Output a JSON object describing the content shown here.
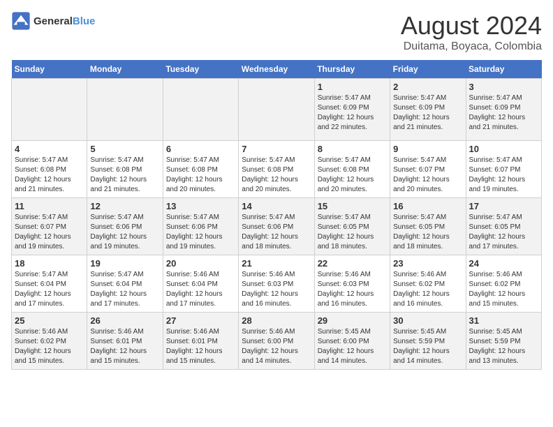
{
  "logo": {
    "line1": "General",
    "line2": "Blue"
  },
  "title": "August 2024",
  "subtitle": "Duitama, Boyaca, Colombia",
  "days_of_week": [
    "Sunday",
    "Monday",
    "Tuesday",
    "Wednesday",
    "Thursday",
    "Friday",
    "Saturday"
  ],
  "weeks": [
    [
      {
        "day": "",
        "info": ""
      },
      {
        "day": "",
        "info": ""
      },
      {
        "day": "",
        "info": ""
      },
      {
        "day": "",
        "info": ""
      },
      {
        "day": "1",
        "info": "Sunrise: 5:47 AM\nSunset: 6:09 PM\nDaylight: 12 hours\nand 22 minutes."
      },
      {
        "day": "2",
        "info": "Sunrise: 5:47 AM\nSunset: 6:09 PM\nDaylight: 12 hours\nand 21 minutes."
      },
      {
        "day": "3",
        "info": "Sunrise: 5:47 AM\nSunset: 6:09 PM\nDaylight: 12 hours\nand 21 minutes."
      }
    ],
    [
      {
        "day": "4",
        "info": "Sunrise: 5:47 AM\nSunset: 6:08 PM\nDaylight: 12 hours\nand 21 minutes."
      },
      {
        "day": "5",
        "info": "Sunrise: 5:47 AM\nSunset: 6:08 PM\nDaylight: 12 hours\nand 21 minutes."
      },
      {
        "day": "6",
        "info": "Sunrise: 5:47 AM\nSunset: 6:08 PM\nDaylight: 12 hours\nand 20 minutes."
      },
      {
        "day": "7",
        "info": "Sunrise: 5:47 AM\nSunset: 6:08 PM\nDaylight: 12 hours\nand 20 minutes."
      },
      {
        "day": "8",
        "info": "Sunrise: 5:47 AM\nSunset: 6:08 PM\nDaylight: 12 hours\nand 20 minutes."
      },
      {
        "day": "9",
        "info": "Sunrise: 5:47 AM\nSunset: 6:07 PM\nDaylight: 12 hours\nand 20 minutes."
      },
      {
        "day": "10",
        "info": "Sunrise: 5:47 AM\nSunset: 6:07 PM\nDaylight: 12 hours\nand 19 minutes."
      }
    ],
    [
      {
        "day": "11",
        "info": "Sunrise: 5:47 AM\nSunset: 6:07 PM\nDaylight: 12 hours\nand 19 minutes."
      },
      {
        "day": "12",
        "info": "Sunrise: 5:47 AM\nSunset: 6:06 PM\nDaylight: 12 hours\nand 19 minutes."
      },
      {
        "day": "13",
        "info": "Sunrise: 5:47 AM\nSunset: 6:06 PM\nDaylight: 12 hours\nand 19 minutes."
      },
      {
        "day": "14",
        "info": "Sunrise: 5:47 AM\nSunset: 6:06 PM\nDaylight: 12 hours\nand 18 minutes."
      },
      {
        "day": "15",
        "info": "Sunrise: 5:47 AM\nSunset: 6:05 PM\nDaylight: 12 hours\nand 18 minutes."
      },
      {
        "day": "16",
        "info": "Sunrise: 5:47 AM\nSunset: 6:05 PM\nDaylight: 12 hours\nand 18 minutes."
      },
      {
        "day": "17",
        "info": "Sunrise: 5:47 AM\nSunset: 6:05 PM\nDaylight: 12 hours\nand 17 minutes."
      }
    ],
    [
      {
        "day": "18",
        "info": "Sunrise: 5:47 AM\nSunset: 6:04 PM\nDaylight: 12 hours\nand 17 minutes."
      },
      {
        "day": "19",
        "info": "Sunrise: 5:47 AM\nSunset: 6:04 PM\nDaylight: 12 hours\nand 17 minutes."
      },
      {
        "day": "20",
        "info": "Sunrise: 5:46 AM\nSunset: 6:04 PM\nDaylight: 12 hours\nand 17 minutes."
      },
      {
        "day": "21",
        "info": "Sunrise: 5:46 AM\nSunset: 6:03 PM\nDaylight: 12 hours\nand 16 minutes."
      },
      {
        "day": "22",
        "info": "Sunrise: 5:46 AM\nSunset: 6:03 PM\nDaylight: 12 hours\nand 16 minutes."
      },
      {
        "day": "23",
        "info": "Sunrise: 5:46 AM\nSunset: 6:02 PM\nDaylight: 12 hours\nand 16 minutes."
      },
      {
        "day": "24",
        "info": "Sunrise: 5:46 AM\nSunset: 6:02 PM\nDaylight: 12 hours\nand 15 minutes."
      }
    ],
    [
      {
        "day": "25",
        "info": "Sunrise: 5:46 AM\nSunset: 6:02 PM\nDaylight: 12 hours\nand 15 minutes."
      },
      {
        "day": "26",
        "info": "Sunrise: 5:46 AM\nSunset: 6:01 PM\nDaylight: 12 hours\nand 15 minutes."
      },
      {
        "day": "27",
        "info": "Sunrise: 5:46 AM\nSunset: 6:01 PM\nDaylight: 12 hours\nand 15 minutes."
      },
      {
        "day": "28",
        "info": "Sunrise: 5:46 AM\nSunset: 6:00 PM\nDaylight: 12 hours\nand 14 minutes."
      },
      {
        "day": "29",
        "info": "Sunrise: 5:45 AM\nSunset: 6:00 PM\nDaylight: 12 hours\nand 14 minutes."
      },
      {
        "day": "30",
        "info": "Sunrise: 5:45 AM\nSunset: 5:59 PM\nDaylight: 12 hours\nand 14 minutes."
      },
      {
        "day": "31",
        "info": "Sunrise: 5:45 AM\nSunset: 5:59 PM\nDaylight: 12 hours\nand 13 minutes."
      }
    ]
  ]
}
